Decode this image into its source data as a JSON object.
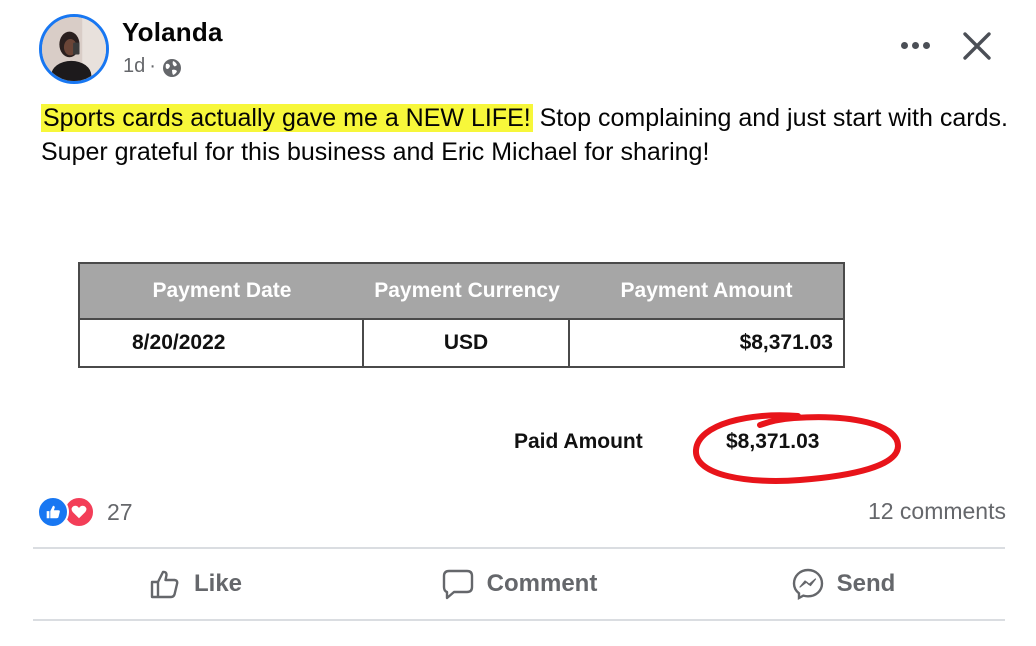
{
  "post": {
    "author": "Yolanda",
    "time": "1d",
    "separator": "·",
    "text_highlighted": "Sports cards actually gave me a NEW LIFE!",
    "text_rest": " Stop complaining and just start with cards. Super grateful for this business and Eric Michael for sharing!"
  },
  "payment": {
    "headers": [
      "Payment Date",
      "Payment Currency",
      "Payment Amount"
    ],
    "row": [
      "8/20/2022",
      "USD",
      "$8,371.03"
    ],
    "paid_label": "Paid Amount",
    "paid_value": "$8,371.03"
  },
  "reactions": {
    "count": "27",
    "comments": "12 comments"
  },
  "actions": {
    "like": "Like",
    "comment": "Comment",
    "send": "Send"
  },
  "icons": {
    "avatar": "profile-photo",
    "privacy": "globe-icon",
    "more": "more-icon",
    "close": "close-icon",
    "like_reaction": "thumbs-up-icon",
    "love_reaction": "heart-icon"
  },
  "colors": {
    "highlight": "#f7f73a",
    "brand": "#1877f2",
    "love": "#f33e58",
    "circle_annotation": "#e8141a",
    "table_header": "#a6a6a6"
  }
}
